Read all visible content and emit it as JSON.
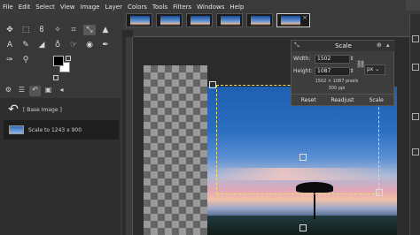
{
  "menu": [
    "File",
    "Edit",
    "Select",
    "View",
    "Image",
    "Layer",
    "Colors",
    "Tools",
    "Filters",
    "Windows",
    "Help"
  ],
  "history": {
    "items": [
      {
        "label": "[ Base Image ]"
      },
      {
        "label": "Scale to 1243 x 900"
      }
    ]
  },
  "scale_dialog": {
    "title": "Scale",
    "width_label": "Width:",
    "width_value": "1502",
    "height_label": "Height:",
    "height_value": "1087",
    "unit": "px",
    "size_info": "1502 × 1087 pixels",
    "resolution_info": "300 ppi",
    "buttons": {
      "reset": "Reset",
      "readjust": "Readjust",
      "scale": "Scale"
    }
  },
  "colors": {
    "accent": "#e8e070",
    "background": "#2b2b2b"
  }
}
